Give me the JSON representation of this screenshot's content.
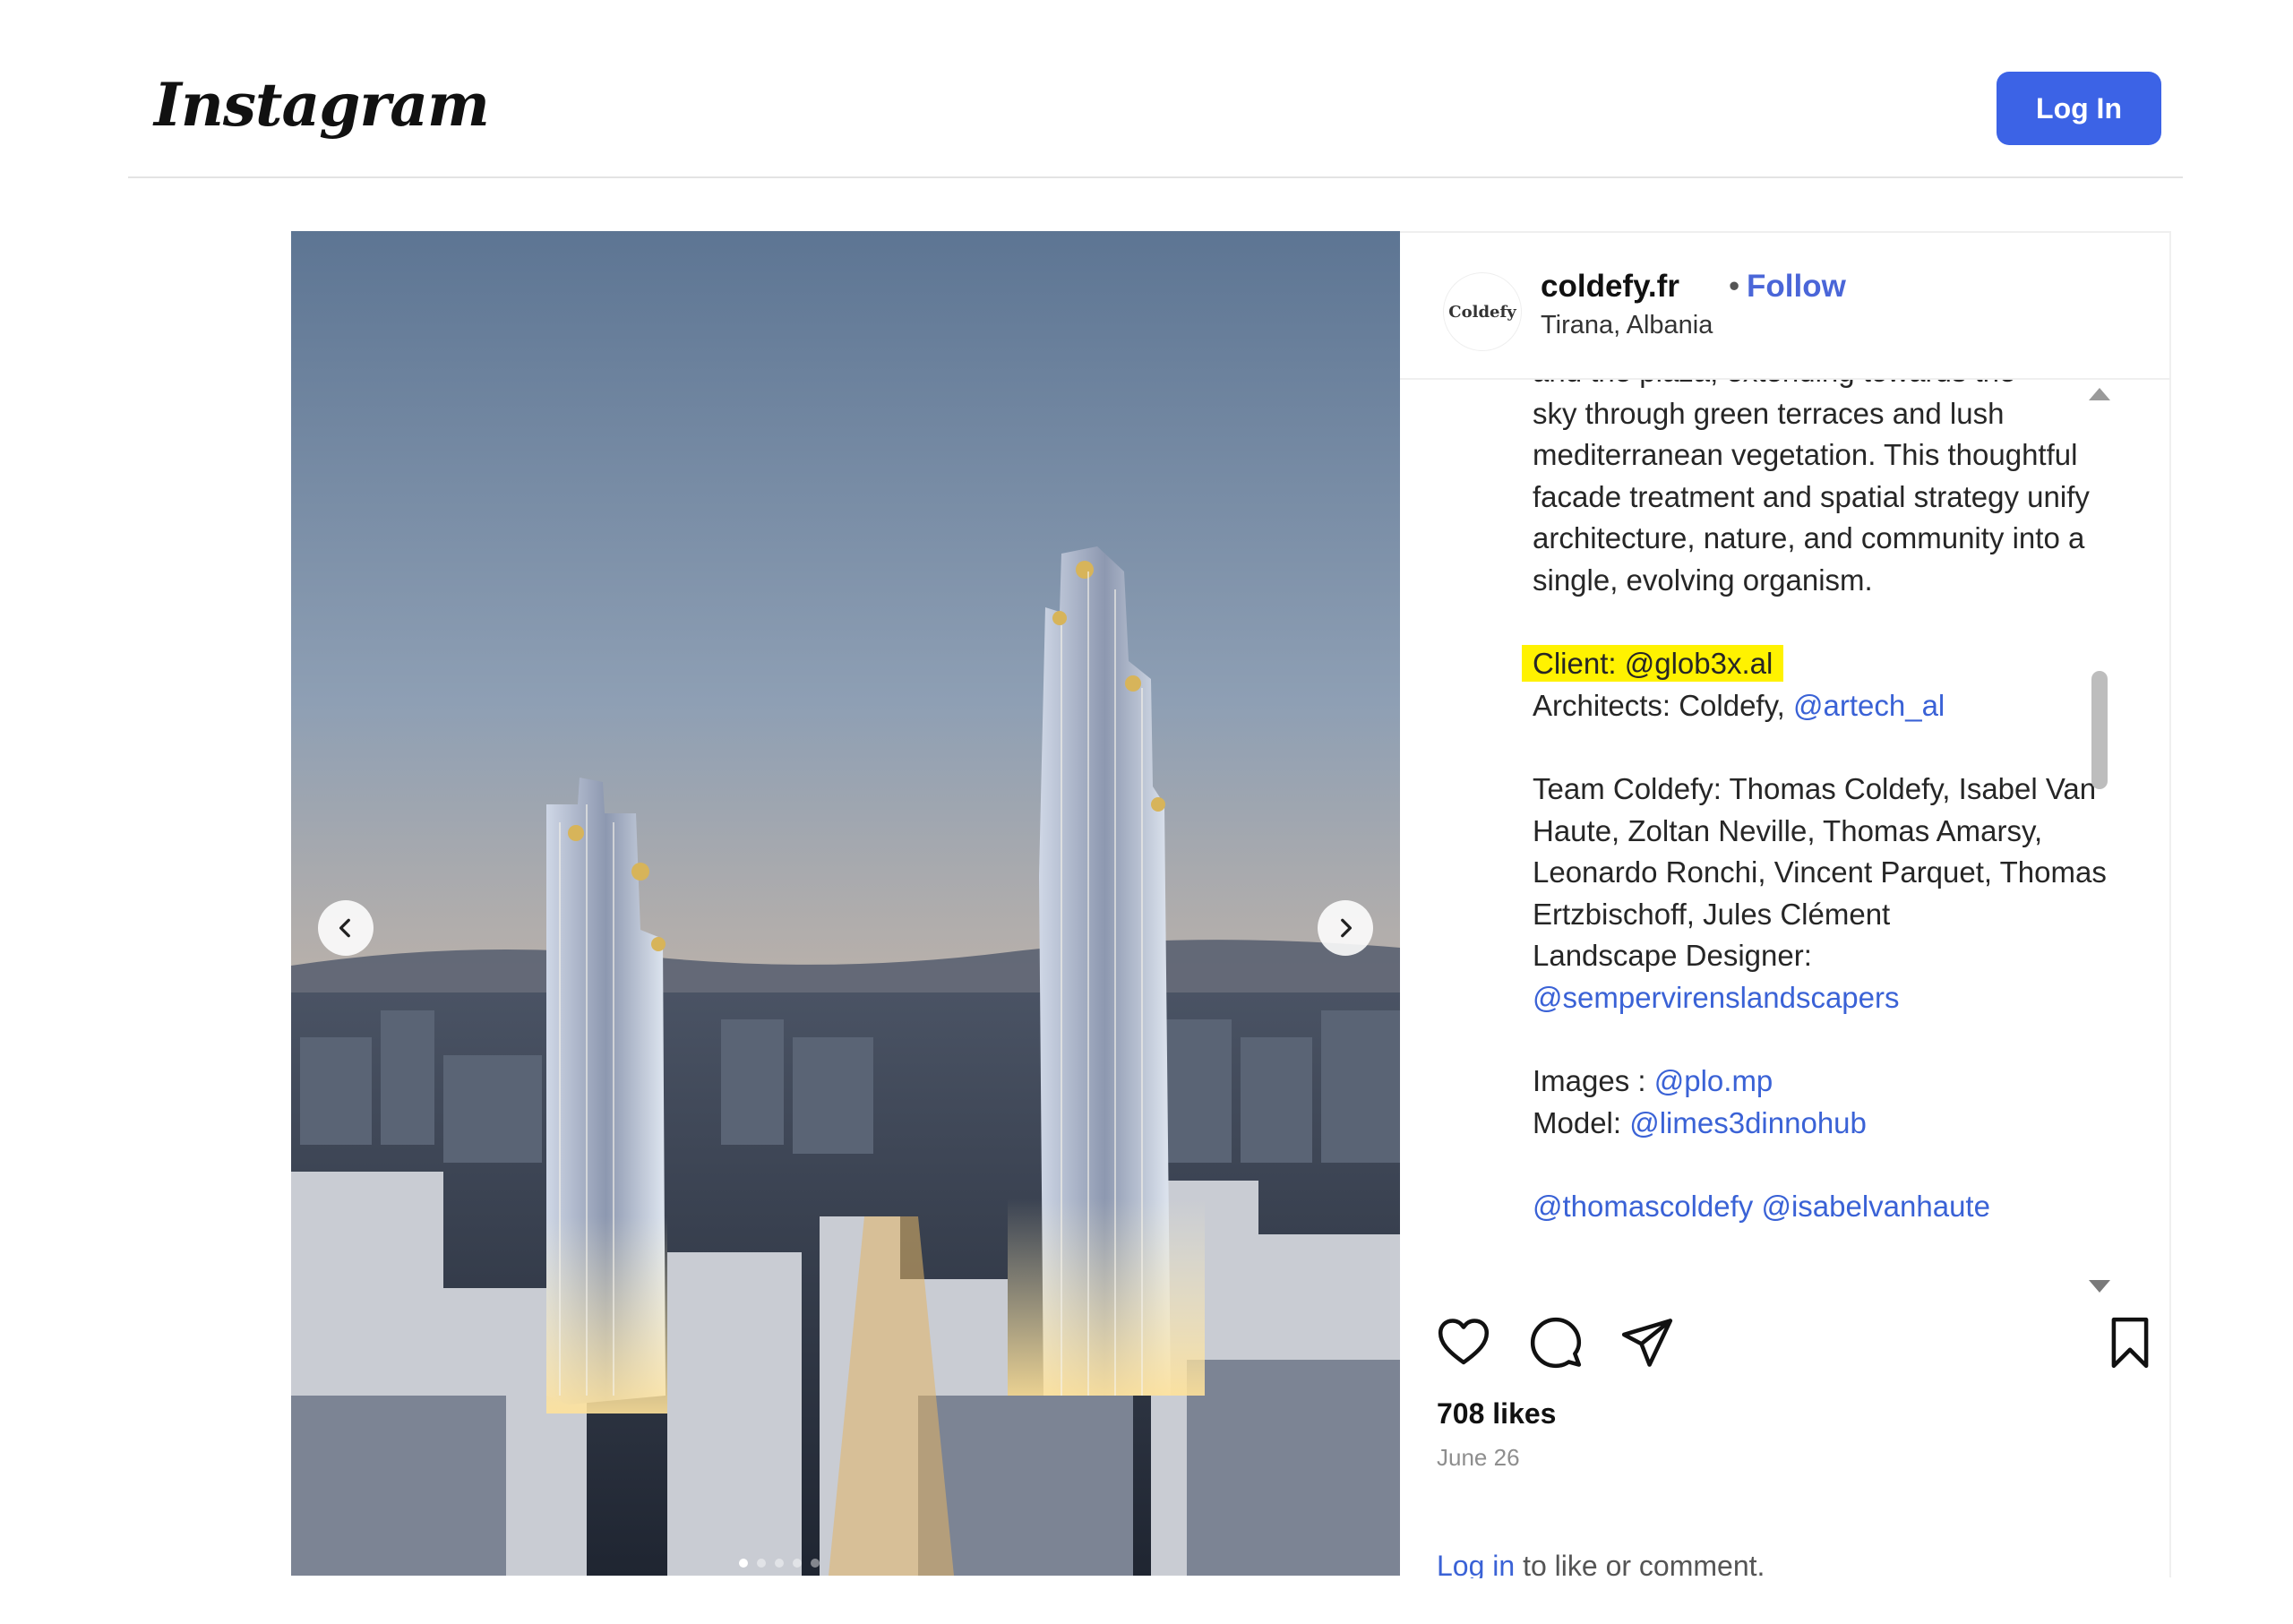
{
  "header": {
    "logo_text": "Instagram",
    "login_label": "Log In"
  },
  "post": {
    "media": {
      "prev_icon": "chevron-left-icon",
      "next_icon": "chevron-right-icon"
    },
    "author": {
      "avatar_text": "Coldefy",
      "username": "coldefy.fr",
      "separator": "•",
      "follow_label": "Follow",
      "location": "Tirana, Albania",
      "more_icon": "more-options-icon"
    },
    "caption": {
      "top_partial": "and the plaza, extending towards the",
      "paragraph1": "sky through green terraces and lush mediterranean vegetation. This thoughtful facade treatment and spatial strategy unify architecture, nature, and community into a single, evolving organism.",
      "client_label": "Client: ",
      "client_handle": "@glob3x.al",
      "architects_label": "Architects: Coldefy, ",
      "architects_handle": "@artech_al",
      "team": "Team Coldefy: Thomas Coldefy, Isabel Van Haute, Zoltan Neville, Thomas Amarsy, Leonardo Ronchi, Vincent Parquet, Thomas Ertzbischoff, Jules Clément",
      "landscape_label": "Landscape Designer:",
      "landscape_handle": "@sempervirenslandscapers",
      "images_label": "Images : ",
      "images_handle": "@plo.mp",
      "model_label": "Model: ",
      "model_handle": "@limes3dinnohub",
      "tags": "@thomascoldefy @isabelvanhaute"
    },
    "actions": {
      "like_icon": "heart-icon",
      "comment_icon": "comment-icon",
      "share_icon": "share-icon",
      "save_icon": "bookmark-icon"
    },
    "likes": "708 likes",
    "date": "June 26",
    "login_prompt_link": "Log in",
    "login_prompt_rest": " to like or comment."
  },
  "colors": {
    "brand_button": "#3c63e6",
    "link": "#3a62d6",
    "highlight": "#fff200"
  }
}
